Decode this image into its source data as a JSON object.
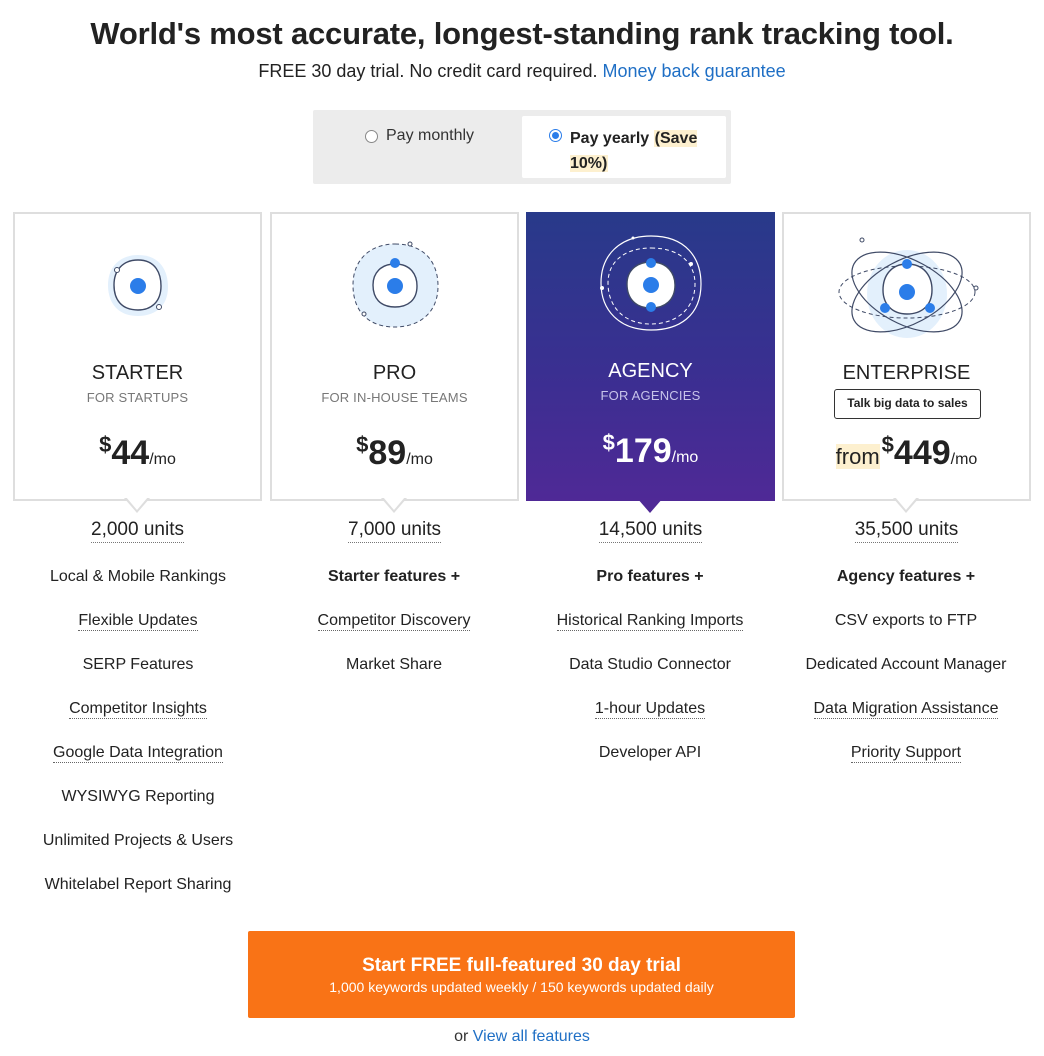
{
  "header": {
    "title": "World's most accurate, longest-standing rank tracking tool.",
    "subtitle": "FREE 30 day trial. No credit card required.",
    "guarantee_link": "Money back guarantee"
  },
  "billing": {
    "monthly_label": "Pay monthly",
    "yearly_label": "Pay yearly",
    "yearly_save": "(Save 10%)",
    "selected": "yearly"
  },
  "plans": [
    {
      "name": "STARTER",
      "tagline": "FOR STARTUPS",
      "currency": "$",
      "price": "44",
      "period": "/mo",
      "units": "2,000 units",
      "features": [
        "Local & Mobile Rankings",
        "Flexible Updates",
        "SERP Features",
        "Competitor Insights",
        "Google Data Integration",
        "WYSIWYG Reporting",
        "Unlimited Projects & Users",
        "Whitelabel Report Sharing"
      ]
    },
    {
      "name": "PRO",
      "tagline": "FOR IN-HOUSE TEAMS",
      "currency": "$",
      "price": "89",
      "period": "/mo",
      "units": "7,000 units",
      "features": [
        "Starter features +",
        "Competitor Discovery",
        "Market Share"
      ]
    },
    {
      "name": "AGENCY",
      "tagline": "FOR AGENCIES",
      "currency": "$",
      "price": "179",
      "period": "/mo",
      "units": "14,500 units",
      "features": [
        "Pro features +",
        "Historical Ranking Imports",
        "Data Studio Connector",
        "1-hour Updates",
        "Developer API"
      ]
    },
    {
      "name": "ENTERPRISE",
      "tagline_button": "Talk big data to sales",
      "price_prefix": "from",
      "currency": "$",
      "price": "449",
      "period": "/mo",
      "units": "35,500 units",
      "features": [
        "Agency features +",
        "CSV exports to FTP",
        "Dedicated Account Manager",
        "Data Migration Assistance",
        "Priority Support"
      ]
    }
  ],
  "cta": {
    "title": "Start FREE full-featured 30 day trial",
    "subtitle": "1,000 keywords updated weekly / 150 keywords updated daily"
  },
  "footer": {
    "prefix": "or",
    "link": "View all features"
  },
  "colors": {
    "accent_blue": "#2b7de9",
    "link": "#1f6fc5",
    "cta_orange": "#f97316",
    "agency_top": "#283a8a",
    "agency_bottom": "#4f2996",
    "highlight": "#fdf0cf"
  }
}
